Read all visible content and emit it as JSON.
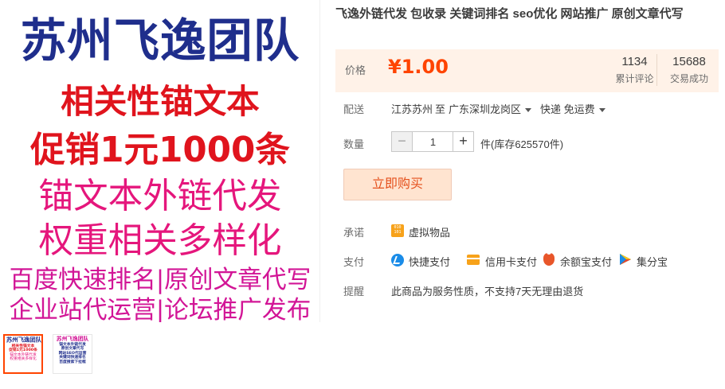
{
  "main_image": {
    "lines": [
      "苏州飞逸团队",
      "相关性锚文本",
      "促销1元1000条",
      "锚文本外链代发",
      "权重相关多样化",
      "百度快速排名|原创文章代写",
      "企业站代运营|论坛推广发布"
    ]
  },
  "thumbnails": [
    {
      "lines": [
        "苏州飞逸团队",
        "相关性锚文本",
        "促销1元1000条",
        "锚文本外链代发",
        "权重相关多样化"
      ]
    },
    {
      "lines": [
        "苏州飞逸团队",
        "锚文本外链代发",
        "原创文章代写",
        "网站SEO代运营",
        "关键词快速排名",
        "百度搜索下拉框"
      ]
    }
  ],
  "product": {
    "title": "飞逸外链代发 包收录 关键词排名 seo优化 网站推广 原创文章代写"
  },
  "price": {
    "label": "价格",
    "value": "¥1.00",
    "reviews_count": "1134",
    "reviews_label": "累计评论",
    "sales_count": "15688",
    "sales_label": "交易成功"
  },
  "shipping": {
    "label": "配送",
    "from": "江苏苏州",
    "to_word": "至",
    "destination": "广东深圳龙岗区",
    "method": "快递 免运费"
  },
  "quantity": {
    "label": "数量",
    "minus": "−",
    "value": "1",
    "plus": "+",
    "stock_text": "件(库存625570件)"
  },
  "buy_button": {
    "label": "立即购买"
  },
  "promise": {
    "label": "承诺",
    "item": "虚拟物品",
    "icon": "virtual-goods-icon"
  },
  "payment": {
    "label": "支付",
    "methods": [
      {
        "label": "快捷支付",
        "icon": "quickpay-icon"
      },
      {
        "label": "信用卡支付",
        "icon": "credit-card-icon"
      },
      {
        "label": "余额宝支付",
        "icon": "yuebao-icon"
      },
      {
        "label": "集分宝",
        "icon": "jifenbao-icon"
      }
    ]
  },
  "notice": {
    "label": "提醒",
    "text": "此商品为服务性质，不支持7天无理由退货"
  },
  "colors": {
    "price": "#ff4400",
    "price_bg": "#fff2e8",
    "buy_button_bg": "#ffe4d0",
    "buy_button_text": "#e5511d"
  }
}
